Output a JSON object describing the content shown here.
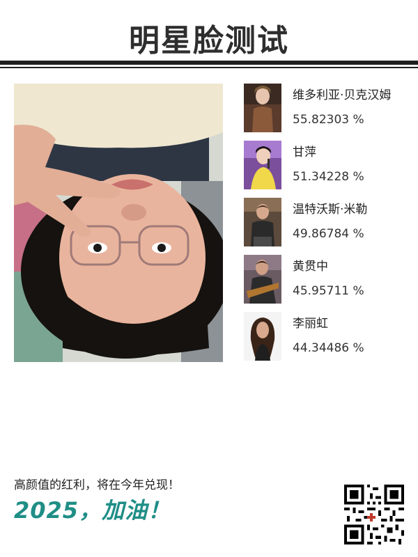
{
  "header": {
    "title": "明星脸测试"
  },
  "matches": [
    {
      "name": "维多利亚·贝克汉姆",
      "score": "55.82303 %"
    },
    {
      "name": "甘萍",
      "score": "51.34228 %"
    },
    {
      "name": "温特沃斯·米勒",
      "score": "49.86784 %"
    },
    {
      "name": "黄贯中",
      "score": "45.95711 %"
    },
    {
      "name": "李丽虹",
      "score": "44.34486 %"
    }
  ],
  "footer": {
    "slogan": "高颜值的红利，将在今年兑现！",
    "cheer": "2025，加油！"
  },
  "colors": {
    "accent": "#1f8e86",
    "rule": "#1f1f1f"
  }
}
